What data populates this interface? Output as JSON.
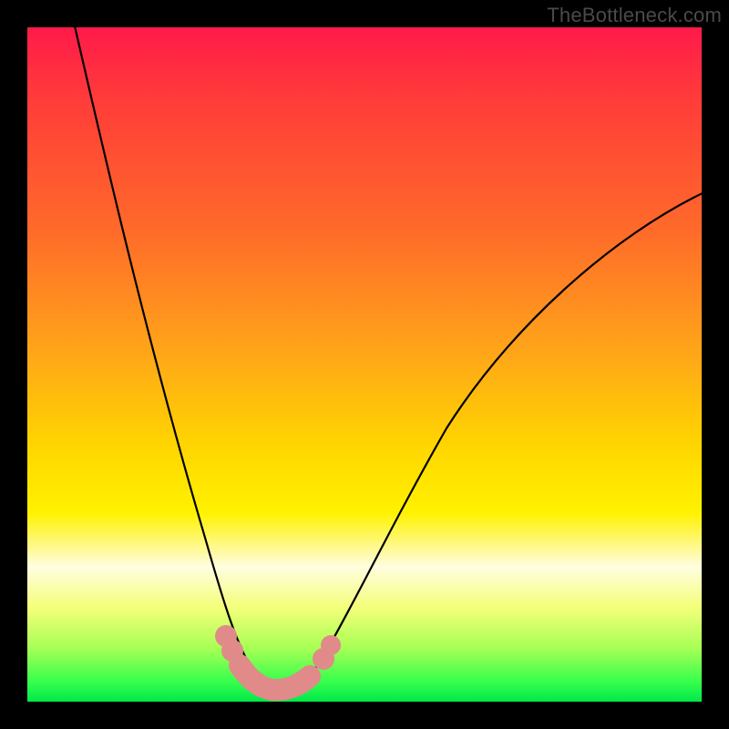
{
  "watermark": "TheBottleneck.com",
  "chart_data": {
    "type": "line",
    "title": "",
    "xlabel": "",
    "ylabel": "",
    "xlim": [
      0,
      100
    ],
    "ylim": [
      0,
      100
    ],
    "grid": false,
    "series": [
      {
        "name": "bottleneck-curve",
        "x": [
          5,
          8,
          12,
          16,
          20,
          24,
          27,
          30,
          32,
          34,
          36,
          38,
          40,
          44,
          48,
          54,
          60,
          68,
          78,
          90,
          100
        ],
        "y": [
          100,
          90,
          78,
          65,
          52,
          38,
          26,
          15,
          8,
          4,
          2,
          2,
          4,
          8,
          15,
          26,
          37,
          49,
          61,
          71,
          78
        ]
      }
    ],
    "highlight": {
      "name": "minimum-band",
      "x_range": [
        30,
        42
      ],
      "y_range": [
        2,
        10
      ]
    },
    "legend": false
  }
}
